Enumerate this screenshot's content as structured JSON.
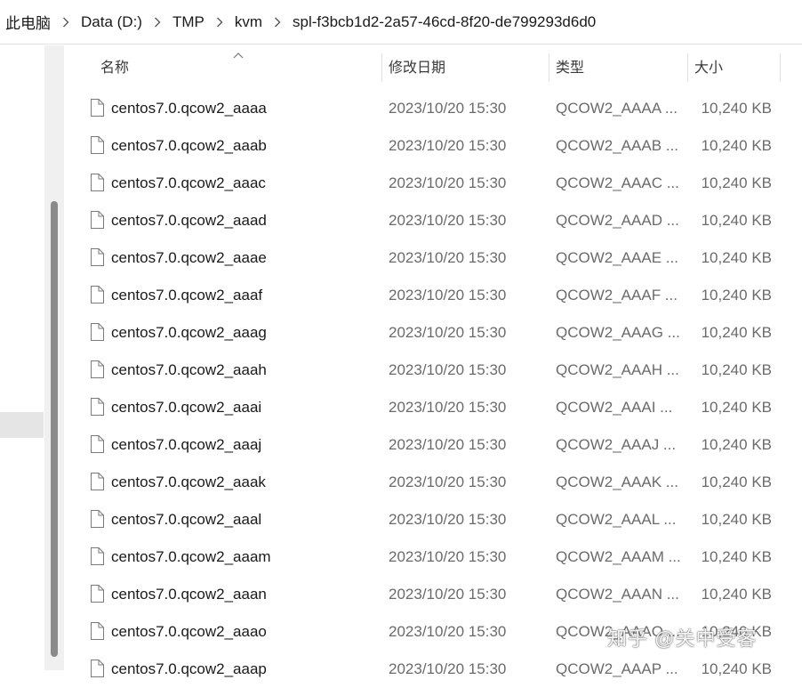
{
  "breadcrumb": {
    "items": [
      "此电脑",
      "Data (D:)",
      "TMP",
      "kvm",
      "spl-f3bcb1d2-2a57-46cd-8f20-de799293d6d0"
    ]
  },
  "columns": {
    "name": "名称",
    "date": "修改日期",
    "type": "类型",
    "size": "大小"
  },
  "files": [
    {
      "name": "centos7.0.qcow2_aaaa",
      "date": "2023/10/20 15:30",
      "type": "QCOW2_AAAA ...",
      "size": "10,240 KB"
    },
    {
      "name": "centos7.0.qcow2_aaab",
      "date": "2023/10/20 15:30",
      "type": "QCOW2_AAAB ...",
      "size": "10,240 KB"
    },
    {
      "name": "centos7.0.qcow2_aaac",
      "date": "2023/10/20 15:30",
      "type": "QCOW2_AAAC ...",
      "size": "10,240 KB"
    },
    {
      "name": "centos7.0.qcow2_aaad",
      "date": "2023/10/20 15:30",
      "type": "QCOW2_AAAD ...",
      "size": "10,240 KB"
    },
    {
      "name": "centos7.0.qcow2_aaae",
      "date": "2023/10/20 15:30",
      "type": "QCOW2_AAAE ...",
      "size": "10,240 KB"
    },
    {
      "name": "centos7.0.qcow2_aaaf",
      "date": "2023/10/20 15:30",
      "type": "QCOW2_AAAF ...",
      "size": "10,240 KB"
    },
    {
      "name": "centos7.0.qcow2_aaag",
      "date": "2023/10/20 15:30",
      "type": "QCOW2_AAAG ...",
      "size": "10,240 KB"
    },
    {
      "name": "centos7.0.qcow2_aaah",
      "date": "2023/10/20 15:30",
      "type": "QCOW2_AAAH ...",
      "size": "10,240 KB"
    },
    {
      "name": "centos7.0.qcow2_aaai",
      "date": "2023/10/20 15:30",
      "type": "QCOW2_AAAI ...",
      "size": "10,240 KB"
    },
    {
      "name": "centos7.0.qcow2_aaaj",
      "date": "2023/10/20 15:30",
      "type": "QCOW2_AAAJ ...",
      "size": "10,240 KB"
    },
    {
      "name": "centos7.0.qcow2_aaak",
      "date": "2023/10/20 15:30",
      "type": "QCOW2_AAAK ...",
      "size": "10,240 KB"
    },
    {
      "name": "centos7.0.qcow2_aaal",
      "date": "2023/10/20 15:30",
      "type": "QCOW2_AAAL ...",
      "size": "10,240 KB"
    },
    {
      "name": "centos7.0.qcow2_aaam",
      "date": "2023/10/20 15:30",
      "type": "QCOW2_AAAM ...",
      "size": "10,240 KB"
    },
    {
      "name": "centos7.0.qcow2_aaan",
      "date": "2023/10/20 15:30",
      "type": "QCOW2_AAAN ...",
      "size": "10,240 KB"
    },
    {
      "name": "centos7.0.qcow2_aaao",
      "date": "2023/10/20 15:30",
      "type": "QCOW2_AAAO ...",
      "size": "10,240 KB"
    },
    {
      "name": "centos7.0.qcow2_aaap",
      "date": "2023/10/20 15:30",
      "type": "QCOW2_AAAP ...",
      "size": "10,240 KB"
    }
  ],
  "icons": {
    "file": "file-icon",
    "separator": "chevron-right-icon",
    "sort": "sort-ascending-icon"
  },
  "watermark": "知乎 @关中受客"
}
